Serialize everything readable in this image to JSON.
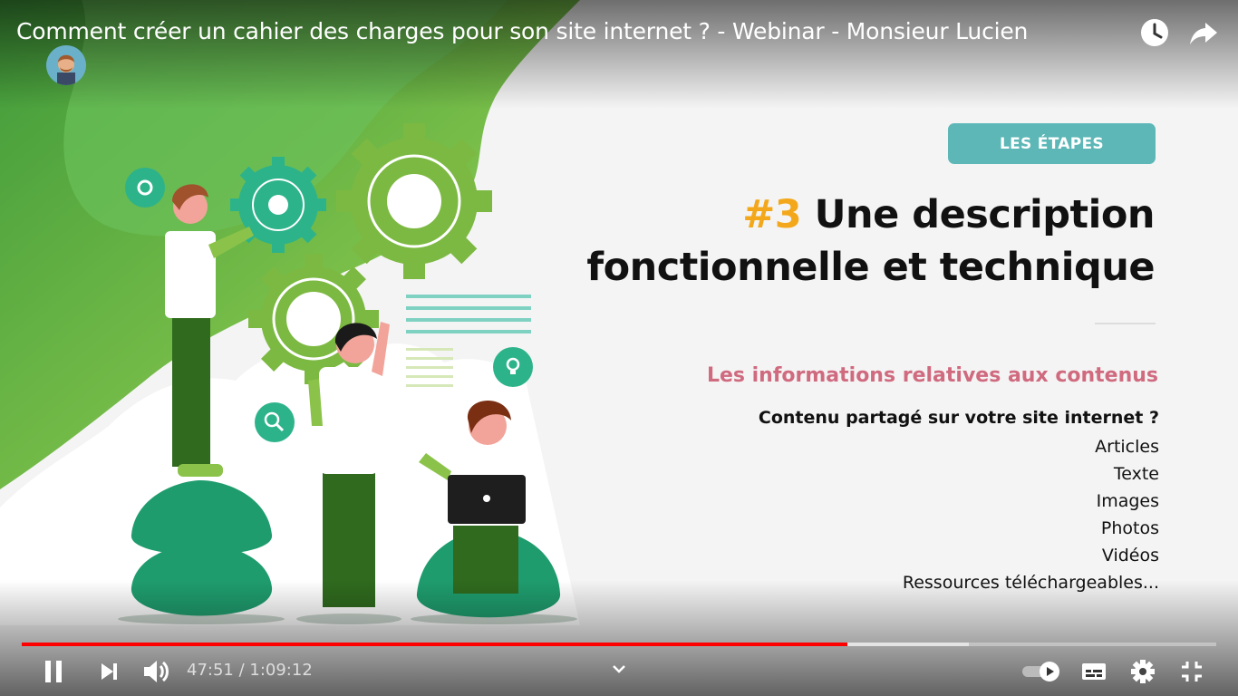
{
  "video": {
    "title": "Comment créer un cahier des charges pour son site internet ? - Webinar - Monsieur Lucien"
  },
  "slide": {
    "badge": "LES ÉTAPES",
    "heading_number": "#3",
    "heading_line1": "Une description",
    "heading_line2": "fonctionnelle et technique",
    "subheading": "Les informations relatives aux contenus",
    "list_title": "Contenu partagé sur votre site internet ?",
    "items": [
      "Articles",
      "Texte",
      "Images",
      "Photos",
      "Vidéos",
      "Ressources téléchargeables..."
    ]
  },
  "controls": {
    "current_time": "47:51",
    "separator": " / ",
    "duration": "1:09:12",
    "played_fraction": 0.691,
    "buffered_fraction": 0.793
  },
  "icons": {
    "top_right": [
      "watch-later-icon",
      "share-icon"
    ],
    "controls_left": [
      "pause-icon",
      "next-icon",
      "volume-icon"
    ],
    "controls_right": [
      "autoplay-toggle-icon",
      "subtitles-icon",
      "settings-icon",
      "exit-fullscreen-icon"
    ]
  },
  "colors": {
    "accent_teal": "#5db7b7",
    "accent_orange": "#f3a81b",
    "accent_pink": "#d06a7f",
    "progress_red": "#ff0000",
    "green": "#7ab83a"
  }
}
